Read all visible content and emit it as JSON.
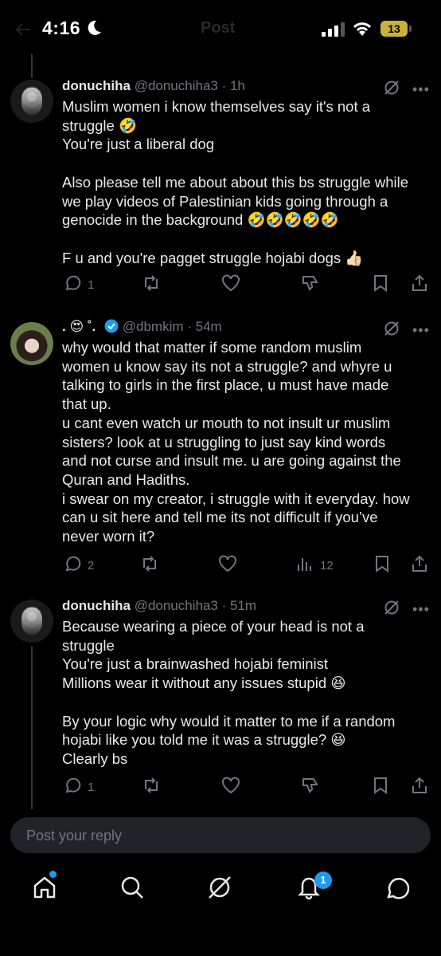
{
  "status_bar": {
    "time": "4:16",
    "battery": "13"
  },
  "header": {
    "title": "Post"
  },
  "tweets": [
    {
      "name": "donuchiha",
      "handle": "@donuchiha3",
      "time": "1h",
      "lines": [
        "Muslim women i know themselves say it's not a",
        "struggle 🤣",
        "You're just a liberal dog",
        "",
        "Also please tell me about about this bs struggle while",
        "we play videos of Palestinian kids going through a",
        "genocide in the background 🤣🤣🤣🤣🤣",
        "",
        "F u and you're pagget struggle hojabi dogs 👍🏻"
      ],
      "replies": "1",
      "reposts": "",
      "likes": ""
    },
    {
      "name": ". 😍 ˚.",
      "handle": "@dbmkim",
      "time": "54m",
      "lines": [
        "why would that matter if some random muslim",
        "women u know say its not a struggle? and whyre u",
        "talking to girls in the first place, u must have made",
        "that up.",
        "u cant even watch ur mouth to not insult ur muslim",
        "sisters? look at u struggling to just say kind words",
        "and not curse and insult me. u are going against the",
        "Quran and Hadiths.",
        "i swear on my creator, i struggle with it everyday. how",
        "can u sit here and tell me its not difficult if you’ve",
        "never worn it?"
      ],
      "replies": "2",
      "views": "12"
    },
    {
      "name": "donuchiha",
      "handle": "@donuchiha3",
      "time": "51m",
      "lines": [
        "Because wearing a piece of your head is not a",
        "struggle",
        "You're just a brainwashed hojabi feminist",
        "Millions wear it without any issues stupid 😆",
        "",
        "By your logic why would it matter to me if a random",
        "hojabi like you told me it was a struggle? 😆",
        "Clearly bs"
      ],
      "replies": "1"
    }
  ],
  "reply_box": {
    "placeholder": "Post your reply"
  },
  "tabbar": {
    "notifications_badge": "1"
  },
  "colors": {
    "accent": "#1d9bf0",
    "muted": "#71767b",
    "text": "#e7e9ea",
    "background": "#000000"
  }
}
